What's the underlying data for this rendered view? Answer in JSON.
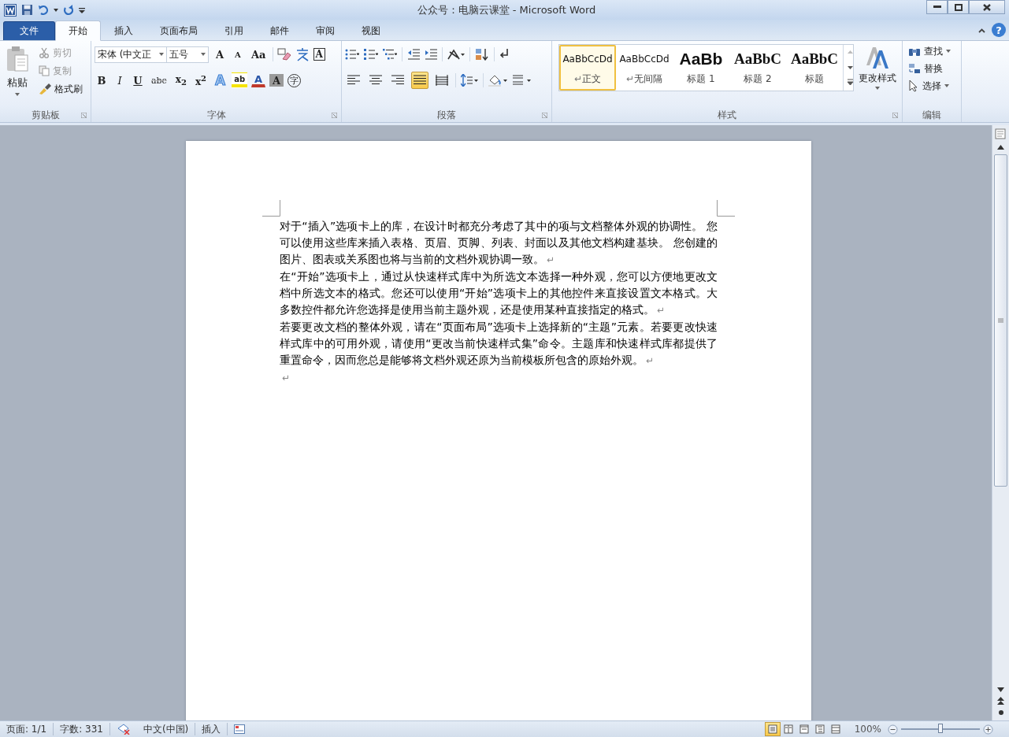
{
  "window": {
    "title": "公众号：电脑云课堂 - Microsoft Word"
  },
  "tabs": [
    {
      "label": "文件",
      "kind": "file",
      "selected": false
    },
    {
      "label": "开始",
      "kind": "tab",
      "selected": true
    },
    {
      "label": "插入",
      "kind": "tab",
      "selected": false
    },
    {
      "label": "页面布局",
      "kind": "tab",
      "selected": false
    },
    {
      "label": "引用",
      "kind": "tab",
      "selected": false
    },
    {
      "label": "邮件",
      "kind": "tab",
      "selected": false
    },
    {
      "label": "审阅",
      "kind": "tab",
      "selected": false
    },
    {
      "label": "视图",
      "kind": "tab",
      "selected": false
    }
  ],
  "help": "?",
  "clipboard": {
    "label": "剪贴板",
    "paste": "粘贴",
    "items": [
      {
        "label": "剪切",
        "disabled": true
      },
      {
        "label": "复制",
        "disabled": true
      },
      {
        "label": "格式刷",
        "disabled": false
      }
    ]
  },
  "font": {
    "label": "字体",
    "name": "宋体 (中文正",
    "size": "五号",
    "row1": [
      "A",
      "A",
      "Aa",
      "A"
    ],
    "row2": [
      "B",
      "I",
      "U",
      "abc",
      "x$_{2}$",
      "x$^{2}$",
      "A",
      "ab",
      "A",
      "A",
      "字"
    ]
  },
  "paragraph": {
    "label": "段落",
    "alignment": [
      {
        "selected": false
      },
      {
        "selected": false
      },
      {
        "selected": false
      },
      {
        "selected": true
      },
      {
        "selected": false
      }
    ]
  },
  "styles": {
    "label": "样式",
    "change_styles": "更改样式",
    "items": [
      {
        "preview": "AaBbCcDd",
        "name": "正文",
        "mark": "↵",
        "kind": "normal",
        "selected": true
      },
      {
        "preview": "AaBbCcDd",
        "name": "无间隔",
        "mark": "↵",
        "kind": "nospacing",
        "selected": false
      },
      {
        "preview": "AaBb",
        "name": "标题 1",
        "kind": "h1",
        "selected": false
      },
      {
        "preview": "AaBbC",
        "name": "标题 2",
        "kind": "h2",
        "selected": false
      },
      {
        "preview": "AaBbC",
        "name": "标题",
        "kind": "title",
        "selected": false
      }
    ]
  },
  "editing": {
    "label": "编辑",
    "items": [
      "查找",
      "替换",
      "选择"
    ]
  },
  "document": {
    "paragraphs": [
      {
        "text": "对于“插入”选项卡上的库，在设计时都充分考虑了其中的项与文档整体外观的协调性。 您可以使用这些库来插入表格、页眉、页脚、列表、封面以及其他文档构建基块。 您创建的图片、图表或关系图也将与当前的文档外观协调一致。",
        "mark": "↵"
      },
      {
        "text": "在“开始”选项卡上，通过从快速样式库中为所选文本选择一种外观，您可以方便地更改文档中所选文本的格式。您还可以使用“开始”选项卡上的其他控件来直接设置文本格式。大多数控件都允许您选择是使用当前主题外观，还是使用某种直接指定的格式。",
        "mark": "↵"
      },
      {
        "text": "若要更改文档的整体外观，请在“页面布局”选项卡上选择新的“主题”元素。若要更改快速样式库中的可用外观，请使用“更改当前快速样式集”命令。主题库和快速样式库都提供了重置命令，因而您总是能够将文档外观还原为当前模板所包含的原始外观。",
        "mark": "↵"
      },
      {
        "mark": "↵"
      }
    ]
  },
  "status_bar": {
    "page": "页面: 1/1",
    "words": "字数: 331",
    "language": "中文(中国)",
    "mode": "插入",
    "views": [
      {
        "selected": true
      },
      {
        "selected": false
      },
      {
        "selected": false
      },
      {
        "selected": false
      },
      {
        "selected": false
      }
    ],
    "zoom": "100%",
    "zoom_slider": {
      "level": 0.5
    }
  }
}
